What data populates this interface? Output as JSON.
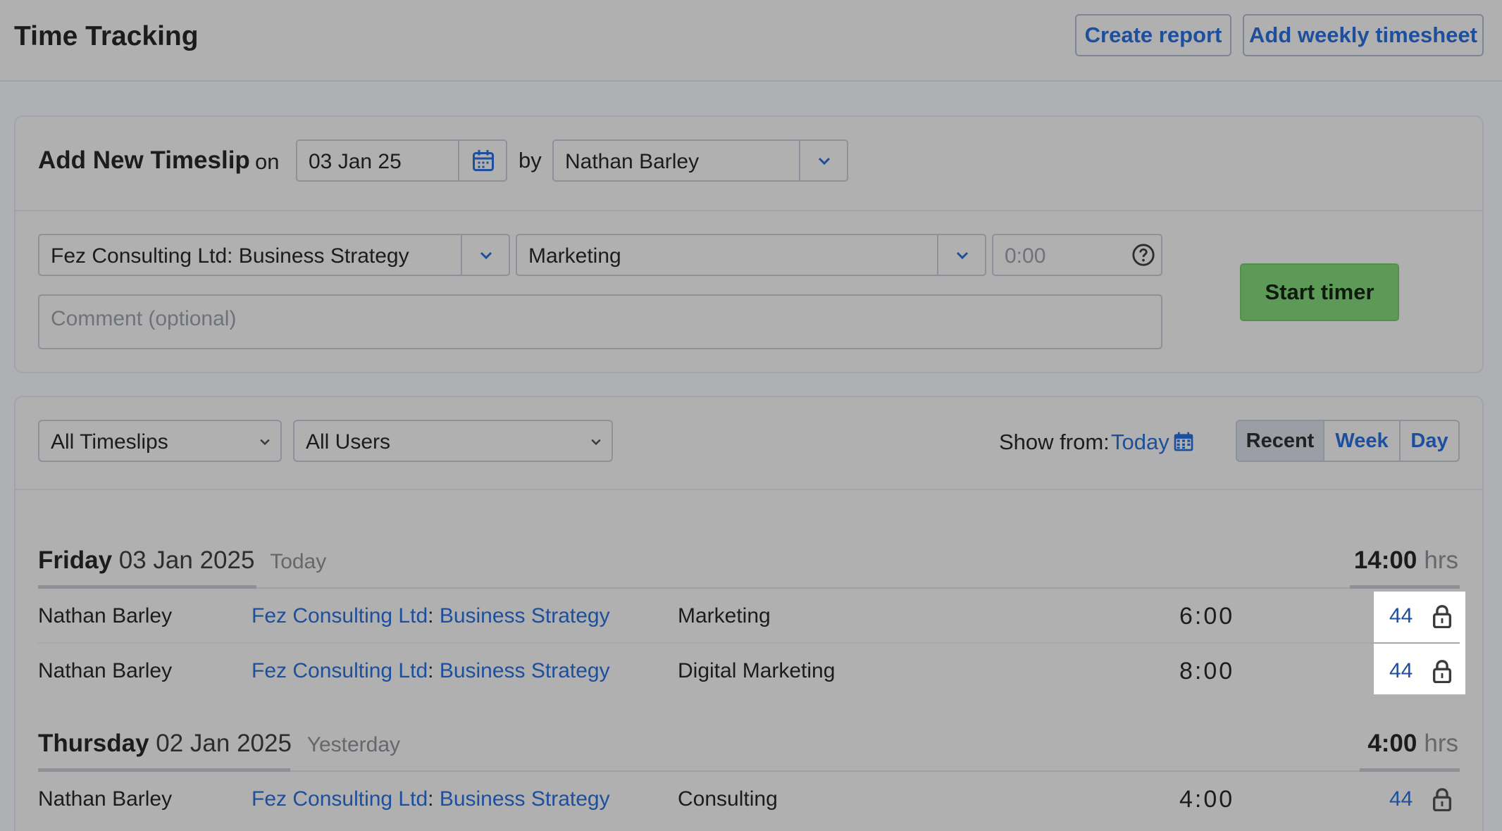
{
  "header": {
    "title": "Time Tracking",
    "create_report": "Create report",
    "add_weekly": "Add weekly timesheet"
  },
  "new_timeslip": {
    "heading": "Add New Timeslip",
    "on_label": "on",
    "date": "03 Jan 25",
    "by_label": "by",
    "user": "Nathan Barley",
    "project": "Fez Consulting Ltd: Business Strategy",
    "task": "Marketing",
    "hours_placeholder": "0:00",
    "comment_placeholder": "Comment (optional)",
    "start_timer": "Start timer"
  },
  "filters": {
    "timeslip_filter": "All Timeslips",
    "user_filter": "All Users",
    "show_from_label": "Show from:",
    "show_from_value": "Today",
    "views": [
      "Recent",
      "Week",
      "Day"
    ],
    "active_view": "Recent"
  },
  "days": [
    {
      "weekday": "Friday",
      "date": "03 Jan 2025",
      "relative": "Today",
      "total": "14:00",
      "unit": "hrs",
      "entries": [
        {
          "user": "Nathan Barley",
          "client": "Fez Consulting Ltd",
          "project": "Business Strategy",
          "task": "Marketing",
          "hours": "6:00",
          "ref": "44"
        },
        {
          "user": "Nathan Barley",
          "client": "Fez Consulting Ltd",
          "project": "Business Strategy",
          "task": "Digital Marketing",
          "hours": "8:00",
          "ref": "44"
        }
      ]
    },
    {
      "weekday": "Thursday",
      "date": "02 Jan 2025",
      "relative": "Yesterday",
      "total": "4:00",
      "unit": "hrs",
      "entries": [
        {
          "user": "Nathan Barley",
          "client": "Fez Consulting Ltd",
          "project": "Business Strategy",
          "task": "Consulting",
          "hours": "4:00",
          "ref": "44"
        }
      ]
    }
  ],
  "colors": {
    "accent_link": "#1e4f9c",
    "start_button": "#5e9a57",
    "background": "#b0b0b0"
  },
  "icons": {
    "date_picker": "calendar-icon",
    "dropdown": "chevron-down-icon",
    "help": "question-circle-icon",
    "locked": "lock-icon"
  }
}
